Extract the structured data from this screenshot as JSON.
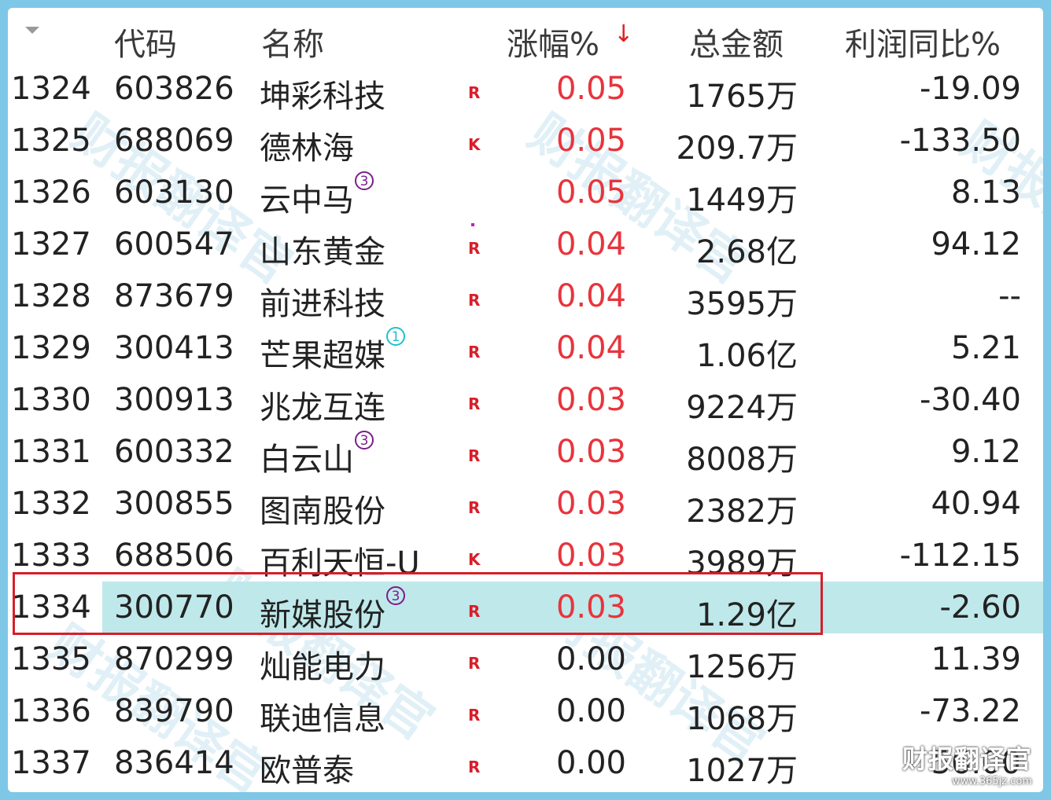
{
  "header": {
    "code": "代码",
    "name": "名称",
    "change": "涨幅%",
    "sort_arrow": "↓",
    "amount": "总金额",
    "profit": "利润同比%"
  },
  "rows": [
    {
      "idx": "1324",
      "code": "603826",
      "name": "坤彩科技",
      "badge": "",
      "mark": "R",
      "change": "0.05",
      "amount": "1765万",
      "profit": "-19.09"
    },
    {
      "idx": "1325",
      "code": "688069",
      "name": "德林海",
      "badge": "",
      "mark": "K",
      "change": "0.05",
      "amount": "209.7万",
      "profit": "-133.50"
    },
    {
      "idx": "1326",
      "code": "603130",
      "name": "云中马",
      "badge": "3",
      "mark": "",
      "change": "0.05",
      "amount": "1449万",
      "profit": "8.13"
    },
    {
      "idx": "1327",
      "code": "600547",
      "name": "山东黄金",
      "badge": "",
      "mark": "R",
      "change": "0.04",
      "amount": "2.68亿",
      "profit": "94.12"
    },
    {
      "idx": "1328",
      "code": "873679",
      "name": "前进科技",
      "badge": "",
      "mark": "R",
      "change": "0.04",
      "amount": "3595万",
      "profit": "--"
    },
    {
      "idx": "1329",
      "code": "300413",
      "name": "芒果超媒",
      "badge": "1",
      "mark": "R",
      "change": "0.04",
      "amount": "1.06亿",
      "profit": "5.21"
    },
    {
      "idx": "1330",
      "code": "300913",
      "name": "兆龙互连",
      "badge": "",
      "mark": "R",
      "change": "0.03",
      "amount": "9224万",
      "profit": "-30.40"
    },
    {
      "idx": "1331",
      "code": "600332",
      "name": "白云山",
      "badge": "3",
      "mark": "R",
      "change": "0.03",
      "amount": "8008万",
      "profit": "9.12"
    },
    {
      "idx": "1332",
      "code": "300855",
      "name": "图南股份",
      "badge": "",
      "mark": "R",
      "change": "0.03",
      "amount": "2382万",
      "profit": "40.94"
    },
    {
      "idx": "1333",
      "code": "688506",
      "name": "百利天恒-U",
      "badge": "",
      "mark": "K",
      "change": "0.03",
      "amount": "3989万",
      "profit": "-112.15"
    },
    {
      "idx": "1334",
      "code": "300770",
      "name": "新媒股份",
      "badge": "3",
      "mark": "R",
      "change": "0.03",
      "amount": "1.29亿",
      "profit": "-2.60"
    },
    {
      "idx": "1335",
      "code": "870299",
      "name": "灿能电力",
      "badge": "",
      "mark": "R",
      "change": "0.00",
      "amount": "1256万",
      "profit": "11.39"
    },
    {
      "idx": "1336",
      "code": "839790",
      "name": "联迪信息",
      "badge": "",
      "mark": "R",
      "change": "0.00",
      "amount": "1068万",
      "profit": "-73.22"
    },
    {
      "idx": "1337",
      "code": "836414",
      "name": "欧普泰",
      "badge": "",
      "mark": "R",
      "change": "0.00",
      "amount": "1027万",
      "profit": "56.00"
    }
  ],
  "selected_row": 10,
  "watermark": "财报翻译官",
  "brand": {
    "name": "财报翻译官",
    "url": "www.365jz.com"
  },
  "colors": {
    "up": "#e8343c",
    "flat": "#222222",
    "selected_bg": "#bfe8ea",
    "selection_border": "#d61f2a",
    "badge_purple": "#7a1e8a",
    "badge_cyan": "#20c0d0"
  }
}
